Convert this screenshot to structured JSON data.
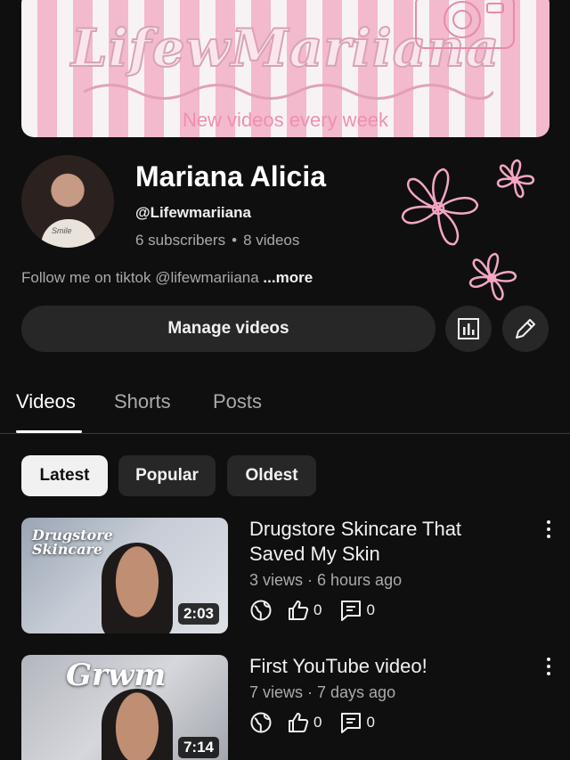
{
  "banner": {
    "title": "LifewMariiana",
    "subtitle": "New videos every week"
  },
  "channel": {
    "name": "Mariana Alicia",
    "handle": "@Lifewmariiana",
    "subscribers": "6 subscribers",
    "separator": "•",
    "videos": "8 videos",
    "description": "Follow me on tiktok @lifewmariiana",
    "more_label": "...more",
    "avatar_shirt_text": "Smile"
  },
  "actions": {
    "manage_label": "Manage videos",
    "analytics_icon": "analytics-icon",
    "edit_icon": "pencil-icon"
  },
  "tabs": [
    {
      "label": "Videos",
      "active": true
    },
    {
      "label": "Shorts",
      "active": false
    },
    {
      "label": "Posts",
      "active": false
    }
  ],
  "chips": [
    {
      "label": "Latest",
      "selected": true
    },
    {
      "label": "Popular",
      "selected": false
    },
    {
      "label": "Oldest",
      "selected": false
    }
  ],
  "videos": [
    {
      "thumb_text": "Drugstore Skincare",
      "duration": "2:03",
      "title": "Drugstore Skincare That Saved My Skin",
      "meta": "3 views · 6 hours ago",
      "likes": "0",
      "comments": "0"
    },
    {
      "thumb_text": "Grwm",
      "duration": "7:14",
      "title": "First YouTube video!",
      "meta": "7 views · 7 days ago",
      "likes": "0",
      "comments": "0"
    }
  ],
  "colors": {
    "background": "#0f0f0f",
    "surface": "#272727",
    "text_primary": "#f1f1f1",
    "text_secondary": "#aaaaaa",
    "banner_pink": "#f3b9cc",
    "flower_pink": "#f4a6c4"
  }
}
